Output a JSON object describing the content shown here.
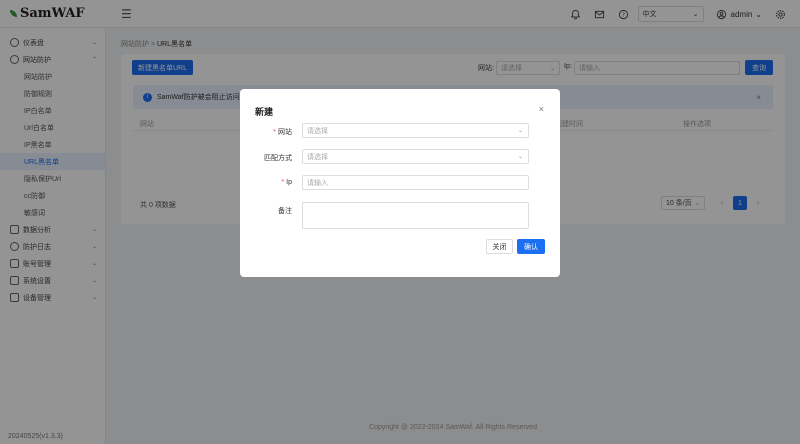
{
  "app": {
    "logo_text": "SamWAF",
    "version": "20240525(v1.3.3)"
  },
  "topbar": {
    "language": "中文",
    "user": "admin"
  },
  "sidebar": {
    "items": [
      {
        "label": "仪表盘",
        "icon": "dashboard-icon",
        "expandable": true
      },
      {
        "label": "网站防护",
        "icon": "shield-icon",
        "expandable": true,
        "expanded": true
      },
      {
        "label": "数据分析",
        "icon": "chart-icon",
        "expandable": true
      },
      {
        "label": "防护日志",
        "icon": "log-icon",
        "expandable": true
      },
      {
        "label": "账号管理",
        "icon": "account-icon",
        "expandable": true
      },
      {
        "label": "系统设置",
        "icon": "settings-icon",
        "expandable": true
      },
      {
        "label": "设备管理",
        "icon": "device-icon",
        "expandable": true
      }
    ],
    "sub_items": [
      {
        "label": "网站防护"
      },
      {
        "label": "防御规则"
      },
      {
        "label": "IP白名单"
      },
      {
        "label": "Url白名单"
      },
      {
        "label": "IP黑名单"
      },
      {
        "label": "URL黑名单",
        "active": true
      },
      {
        "label": "隐私保护Url"
      },
      {
        "label": "cc防御"
      },
      {
        "label": "敏感词"
      }
    ]
  },
  "breadcrumb": {
    "parent": "网站防护",
    "sep": ">",
    "current": "URL黑名单"
  },
  "main": {
    "add_button": "新建黑名单URL",
    "filter_site_label": "网站:",
    "filter_site_placeholder": "请选择",
    "filter_ip_label": "Ip:",
    "filter_ip_placeholder": "请输入",
    "query_button": "查询",
    "alert_text": "SamWaf防护被会阻止访问",
    "table_headers": [
      "网站",
      "创建时间",
      "操作选项"
    ],
    "total_text": "共 0 项数据",
    "page_size": "10 条/页",
    "current_page": "1"
  },
  "modal": {
    "title": "新建",
    "fields": [
      {
        "label": "网站",
        "required": true,
        "placeholder": "请选择",
        "type": "select"
      },
      {
        "label": "匹配方式",
        "required": false,
        "placeholder": "请选择",
        "type": "select"
      },
      {
        "label": "Ip",
        "required": true,
        "placeholder": "请输入",
        "type": "input"
      },
      {
        "label": "备注",
        "required": false,
        "placeholder": "",
        "type": "textarea"
      }
    ],
    "close_button": "关闭",
    "confirm_button": "确认"
  },
  "footer": {
    "copyright": "Copyright @ 2022-2024 SamWaf. All Rights Reserved"
  },
  "colors": {
    "accent": "#1d6ff2",
    "required": "#e34d59",
    "active_bg": "#e8efff"
  }
}
